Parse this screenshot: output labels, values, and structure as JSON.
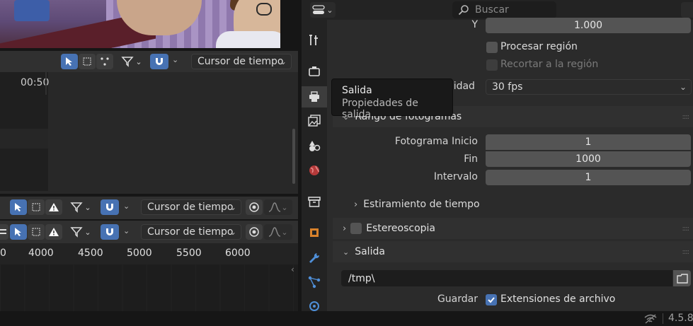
{
  "viewport": {
    "label": "3D viewport render preview"
  },
  "timeline_top": {
    "time_label": "00:50",
    "playhead_dropdown": "Cursor de tiempo"
  },
  "timeline_mid": {
    "playhead_dropdown": "Cursor de tiempo"
  },
  "timeline_bottom": {
    "playhead_dropdown": "Cursor de tiempo",
    "ruler_ticks": [
      "0",
      "4000",
      "4500",
      "5000",
      "5500",
      "6000"
    ]
  },
  "properties": {
    "search_placeholder": "Buscar",
    "y_label": "Y",
    "y_value": "1.000",
    "process_region_label": "Procesar región",
    "crop_region_label": "Recortar a la región",
    "framerate_label_partial": "cidad",
    "framerate_value": "30 fps",
    "frame_range_title": "Rango de fotogramas",
    "frame_start_label": "Fotograma  Inicio",
    "frame_start_value": "1",
    "frame_end_label": "Fin",
    "frame_end_value": "1000",
    "frame_step_label": "Intervalo",
    "frame_step_value": "1",
    "time_stretch_title": "Estiramiento de tiempo",
    "stereoscopy_title": "Estereoscopia",
    "output_title": "Salida",
    "output_path": "/tmp\\",
    "save_label": "Guardar",
    "file_extensions_label": "Extensiones de archivo"
  },
  "tooltip": {
    "title": "Salida",
    "description": "Propiedades de salida"
  },
  "statusbar": {
    "version": "4.5.8"
  },
  "colors": {
    "accent": "#4772b3",
    "panel": "#2b2b2b",
    "field": "#545454"
  }
}
